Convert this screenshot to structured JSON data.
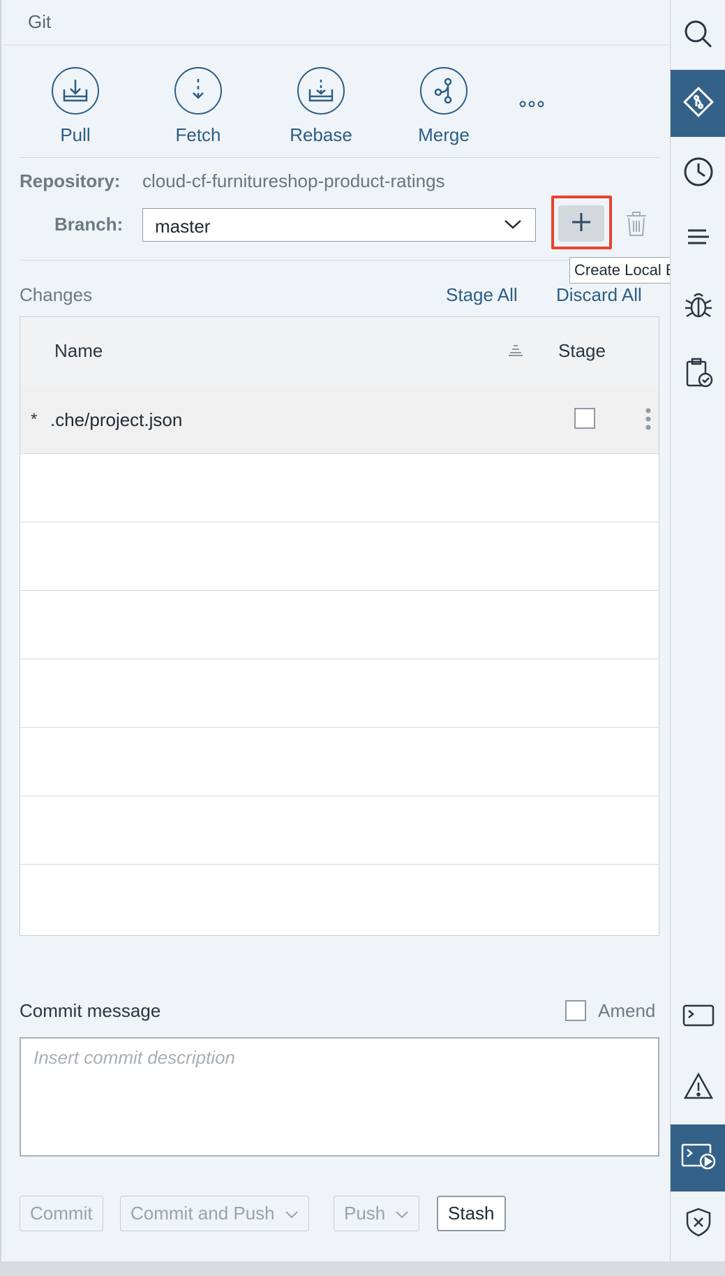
{
  "panel": {
    "title": "Git"
  },
  "actions": [
    {
      "label": "Pull",
      "icon": "pull-icon"
    },
    {
      "label": "Fetch",
      "icon": "fetch-icon"
    },
    {
      "label": "Rebase",
      "icon": "rebase-icon"
    },
    {
      "label": "Merge",
      "icon": "merge-icon"
    }
  ],
  "more_icon": "ellipsis-icon",
  "repository": {
    "label": "Repository:",
    "value": "cloud-cf-furnitureshop-product-ratings"
  },
  "branch": {
    "label": "Branch:",
    "selected": "master"
  },
  "tooltip": {
    "text": "Create Local Branch"
  },
  "changes": {
    "title": "Changes",
    "stage_all": "Stage All",
    "discard_all": "Discard All",
    "columns": {
      "name": "Name",
      "stage": "Stage"
    },
    "rows": [
      {
        "marker": "*",
        "name": ".che/project.json",
        "staged": false
      }
    ]
  },
  "commit": {
    "label": "Commit message",
    "amend_label": "Amend",
    "placeholder": "Insert commit description",
    "value": ""
  },
  "buttons": {
    "commit": "Commit",
    "commit_and_push": "Commit and Push",
    "push": "Push",
    "stash": "Stash"
  },
  "sidebar": [
    {
      "icon": "search-icon",
      "active": false
    },
    {
      "icon": "git-icon",
      "active": true
    },
    {
      "icon": "history-icon",
      "active": false
    },
    {
      "icon": "outline-icon",
      "active": false
    },
    {
      "icon": "debug-icon",
      "active": false
    },
    {
      "icon": "clipboard-check-icon",
      "active": false
    },
    {
      "icon": "terminal-icon",
      "active": false
    },
    {
      "icon": "warning-icon",
      "active": false
    },
    {
      "icon": "run-console-icon",
      "active": true
    },
    {
      "icon": "security-shield-icon",
      "active": false
    }
  ],
  "colors": {
    "accent": "#2d5d83",
    "sidebar_active": "#346187",
    "highlight": "#e8432e",
    "background": "#eff4f9"
  }
}
